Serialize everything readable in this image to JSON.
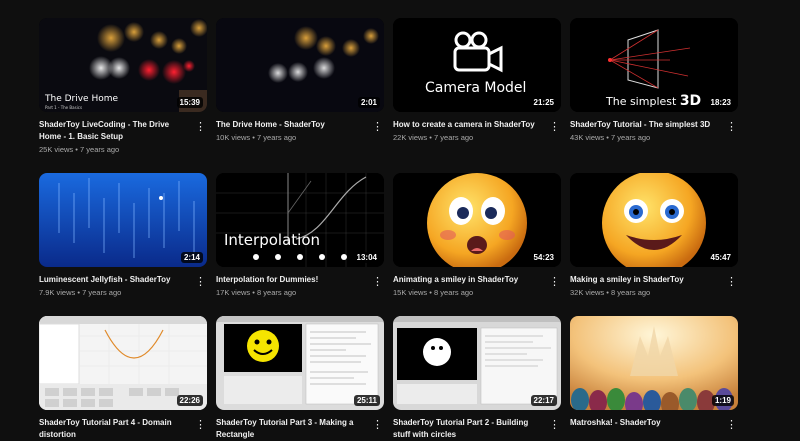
{
  "videos": [
    {
      "title": "ShaderToy LiveCoding - The Drive Home - 1. Basic Setup",
      "views": "25K views",
      "age": "7 years ago",
      "duration": "15:39",
      "thumb_text": "The Drive Home",
      "thumb_subtext": "Part 1 - The Basics"
    },
    {
      "title": "The Drive Home - ShaderToy",
      "views": "10K views",
      "age": "7 years ago",
      "duration": "2:01"
    },
    {
      "title": "How to create a camera in ShaderToy",
      "views": "22K views",
      "age": "7 years ago",
      "duration": "21:25",
      "thumb_text": "Camera Model"
    },
    {
      "title": "ShaderToy Tutorial - The simplest 3D",
      "views": "43K views",
      "age": "7 years ago",
      "duration": "18:23",
      "thumb_text": "The simplest",
      "thumb_text2": "3D"
    },
    {
      "title": "Luminescent Jellyfish - ShaderToy",
      "views": "7.9K views",
      "age": "7 years ago",
      "duration": "2:14"
    },
    {
      "title": "Interpolation for Dummies!",
      "views": "17K views",
      "age": "8 years ago",
      "duration": "13:04",
      "thumb_text": "Interpolation"
    },
    {
      "title": "Animating a smiley in ShaderToy",
      "views": "15K views",
      "age": "8 years ago",
      "duration": "54:23"
    },
    {
      "title": "Making a smiley in ShaderToy",
      "views": "32K views",
      "age": "8 years ago",
      "duration": "45:47"
    },
    {
      "title": "ShaderToy Tutorial Part 4 - Domain distortion",
      "duration": "22:26"
    },
    {
      "title": "ShaderToy Tutorial Part 3 - Making a Rectangle",
      "duration": "25:11"
    },
    {
      "title": "ShaderToy Tutorial Part 2 - Building stuff with circles",
      "duration": "22:17"
    },
    {
      "title": "Matroshka! - ShaderToy",
      "duration": "1:19"
    }
  ],
  "separator": "•",
  "more_glyph": "⋮",
  "colors": {
    "background": "#0f0f0f",
    "title": "#f1f1f1",
    "meta": "#aaaaaa"
  }
}
